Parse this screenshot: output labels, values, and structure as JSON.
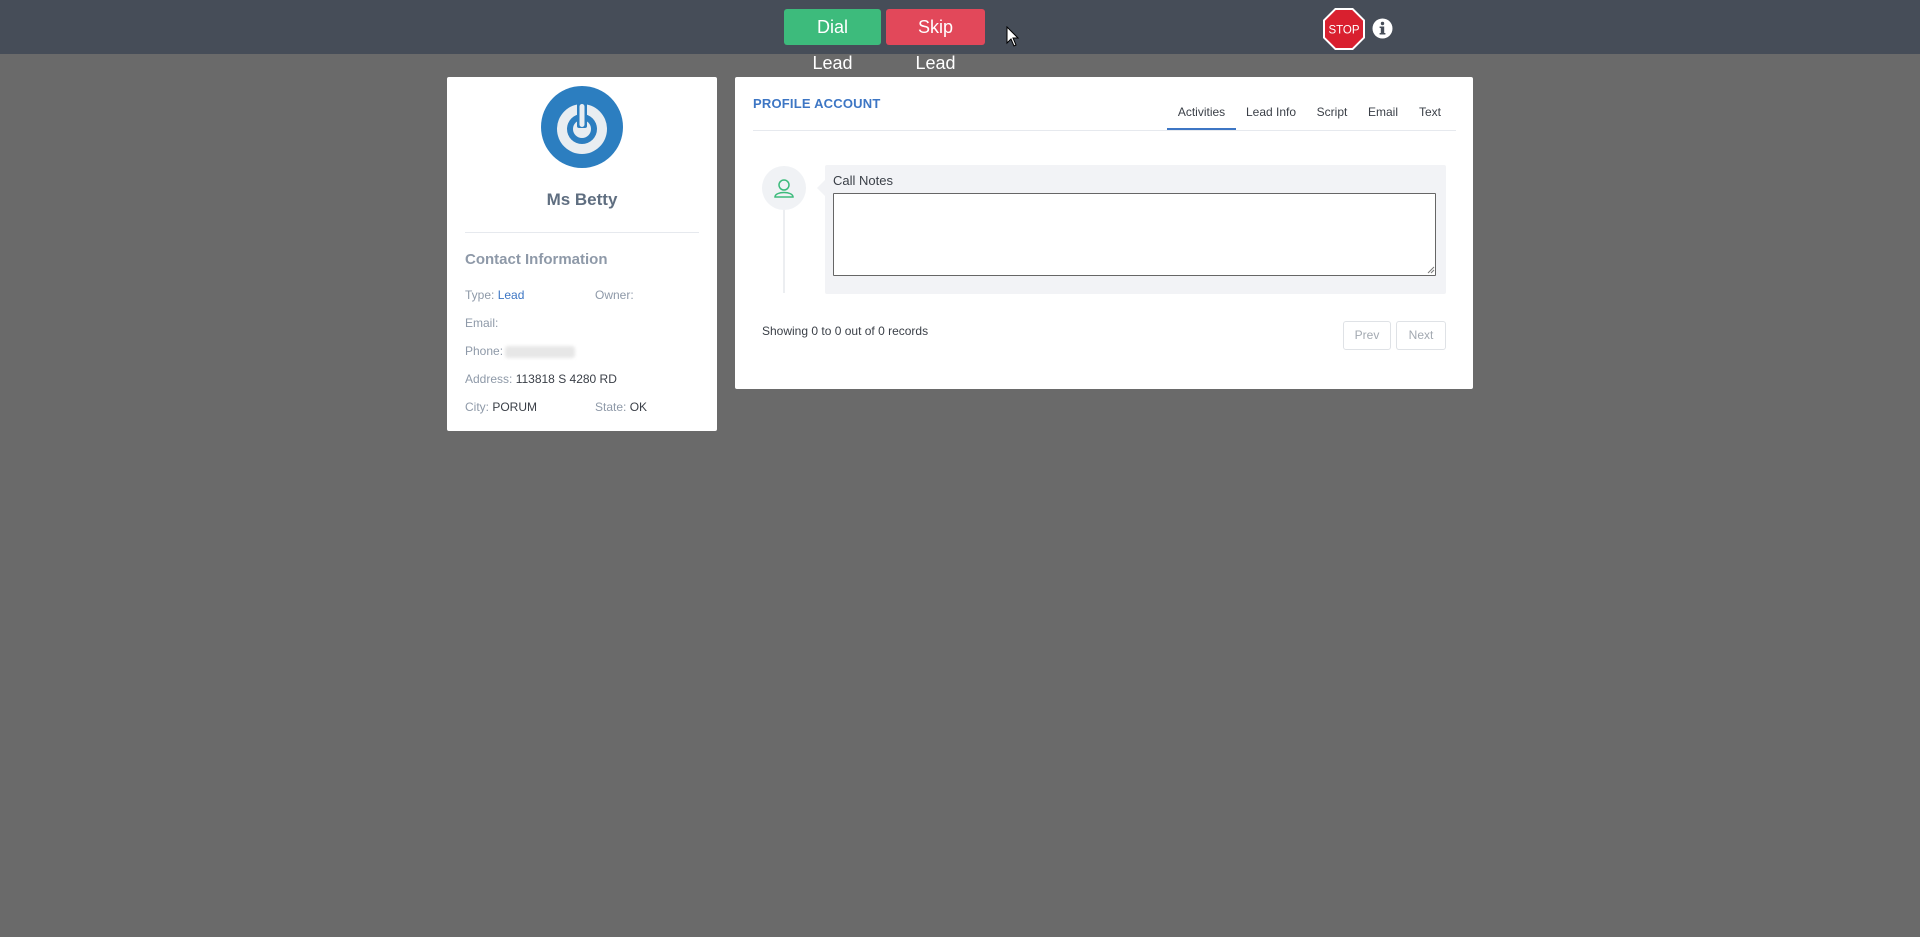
{
  "toolbar": {
    "dial_label": "Dial Lead",
    "skip_label": "Skip Lead",
    "stop_label": "STOP"
  },
  "profile": {
    "name": "Ms Betty",
    "contact_title": "Contact Information",
    "fields": {
      "type_label": "Type:",
      "type_value": "Lead",
      "owner_label": "Owner:",
      "owner_value": "",
      "email_label": "Email:",
      "email_value": "",
      "phone_label": "Phone:",
      "address_label": "Address:",
      "address_value": "113818 S 4280 RD",
      "city_label": "City:",
      "city_value": "PORUM",
      "state_label": "State:",
      "state_value": "OK"
    }
  },
  "account": {
    "title": "PROFILE ACCOUNT",
    "tabs": [
      {
        "label": "Activities"
      },
      {
        "label": "Lead Info"
      },
      {
        "label": "Script"
      },
      {
        "label": "Email"
      },
      {
        "label": "Text"
      }
    ],
    "note_label": "Call Notes",
    "note_value": "",
    "records_text": "Showing 0 to 0 out of 0 records",
    "prev_label": "Prev",
    "next_label": "Next"
  },
  "colors": {
    "accent": "#3d76c4",
    "dial_green": "#3dbb7c",
    "skip_red": "#e2485a",
    "topbar": "#464d58",
    "background": "#6a6a6a"
  }
}
